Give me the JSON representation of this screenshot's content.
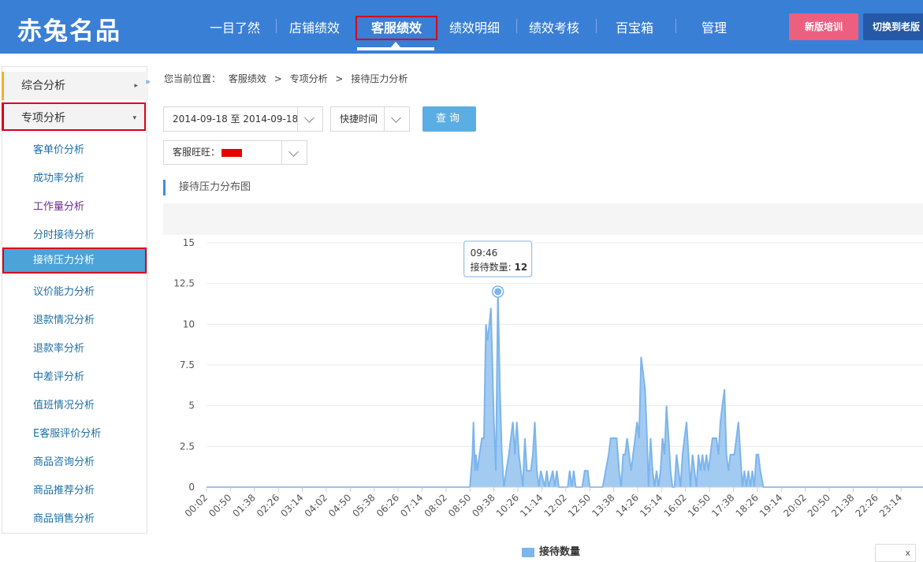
{
  "brand": {
    "logo": "赤兔名品"
  },
  "nav": {
    "items": [
      "一目了然",
      "店铺绩效",
      "客服绩效",
      "绩效明细",
      "绩效考核",
      "百宝箱",
      "管理"
    ],
    "active": "客服绩效"
  },
  "buttons": {
    "training": "新版培训",
    "switch_old": "切换到老版"
  },
  "sidebar": {
    "collapse_icon": "»",
    "groups": [
      {
        "label": "综合分析",
        "arrow": "▸"
      },
      {
        "label": "专项分析",
        "arrow": "▾"
      }
    ],
    "items": [
      "客单价分析",
      "成功率分析",
      "工作量分析",
      "分时接待分析",
      "接待压力分析",
      "议价能力分析",
      "退款情况分析",
      "退款率分析",
      "中差评分析",
      "值班情况分析",
      "E客服评价分析",
      "商品咨询分析",
      "商品推荐分析",
      "商品销售分析"
    ],
    "active_item": "接待压力分析"
  },
  "breadcrumb": {
    "prefix": "您当前位置：",
    "parts": [
      "客服绩效",
      "专项分析",
      "接待压力分析"
    ],
    "sep": ">"
  },
  "filters": {
    "date_range": "2014-09-18 至 2014-09-18",
    "quick_time": "快捷时间",
    "query_button": "查询",
    "wangwang_label": "客服旺旺："
  },
  "section_title": "接待压力分布图",
  "tooltip": {
    "time": "09:46",
    "label": "接待数量:",
    "value": "12"
  },
  "close_label": "x",
  "chart_data": {
    "type": "area",
    "title": "",
    "ylim": [
      0,
      15
    ],
    "yticks": [
      "0",
      "2.5",
      "5",
      "7.5",
      "10",
      "12.5",
      "15"
    ],
    "xtick_labels": [
      "00:02",
      "00:50",
      "01:38",
      "02:26",
      "03:14",
      "04:02",
      "04:50",
      "05:38",
      "06:26",
      "07:14",
      "08:02",
      "08:50",
      "09:38",
      "10:26",
      "11:14",
      "12:02",
      "12:50",
      "13:38",
      "14:26",
      "15:14",
      "16:02",
      "16:50",
      "17:38",
      "18:26",
      "19:14",
      "20:02",
      "20:50",
      "21:38",
      "22:26",
      "23:14"
    ],
    "series": [
      {
        "name": "接待数量",
        "color": "#7cb5ec",
        "points": [
          [
            "00:02",
            0
          ],
          [
            "08:50",
            0
          ],
          [
            "08:55",
            2
          ],
          [
            "08:57",
            4
          ],
          [
            "09:00",
            1
          ],
          [
            "09:02",
            2
          ],
          [
            "09:05",
            1
          ],
          [
            "09:09",
            2
          ],
          [
            "09:14",
            3
          ],
          [
            "09:18",
            3
          ],
          [
            "09:22",
            10
          ],
          [
            "09:25",
            9
          ],
          [
            "09:29",
            10
          ],
          [
            "09:32",
            11
          ],
          [
            "09:38",
            4
          ],
          [
            "09:42",
            1
          ],
          [
            "09:46",
            12
          ],
          [
            "09:50",
            6
          ],
          [
            "09:54",
            2
          ],
          [
            "09:58",
            0
          ],
          [
            "10:03",
            1
          ],
          [
            "10:08",
            2
          ],
          [
            "10:12",
            3
          ],
          [
            "10:16",
            4
          ],
          [
            "10:20",
            2
          ],
          [
            "10:24",
            4
          ],
          [
            "10:28",
            2
          ],
          [
            "10:32",
            1
          ],
          [
            "10:36",
            0
          ],
          [
            "10:40",
            3
          ],
          [
            "10:44",
            1
          ],
          [
            "10:48",
            1
          ],
          [
            "10:52",
            1
          ],
          [
            "10:56",
            2
          ],
          [
            "11:00",
            4
          ],
          [
            "11:04",
            1
          ],
          [
            "11:08",
            0
          ],
          [
            "11:12",
            1
          ],
          [
            "11:20",
            0
          ],
          [
            "11:24",
            1
          ],
          [
            "11:28",
            0
          ],
          [
            "11:36",
            1
          ],
          [
            "11:40",
            0
          ],
          [
            "11:44",
            1
          ],
          [
            "11:48",
            0
          ],
          [
            "12:06",
            0
          ],
          [
            "12:10",
            1
          ],
          [
            "12:14",
            0
          ],
          [
            "12:18",
            1
          ],
          [
            "12:22",
            0
          ],
          [
            "12:35",
            0
          ],
          [
            "12:40",
            1
          ],
          [
            "12:46",
            1
          ],
          [
            "12:50",
            0
          ],
          [
            "13:16",
            0
          ],
          [
            "13:22",
            1
          ],
          [
            "13:28",
            2
          ],
          [
            "13:32",
            3
          ],
          [
            "13:44",
            3
          ],
          [
            "13:49",
            1
          ],
          [
            "13:53",
            0
          ],
          [
            "13:57",
            2
          ],
          [
            "14:01",
            2
          ],
          [
            "14:05",
            3
          ],
          [
            "14:09",
            2
          ],
          [
            "14:13",
            1
          ],
          [
            "14:17",
            2
          ],
          [
            "14:21",
            3
          ],
          [
            "14:25",
            4
          ],
          [
            "14:29",
            3
          ],
          [
            "14:33",
            8
          ],
          [
            "14:37",
            7
          ],
          [
            "14:41",
            6
          ],
          [
            "14:45",
            3
          ],
          [
            "14:48",
            0
          ],
          [
            "14:52",
            3
          ],
          [
            "14:56",
            1
          ],
          [
            "15:00",
            0
          ],
          [
            "15:04",
            1
          ],
          [
            "15:08",
            0
          ],
          [
            "15:12",
            1
          ],
          [
            "15:16",
            3
          ],
          [
            "15:20",
            2
          ],
          [
            "15:24",
            5
          ],
          [
            "15:28",
            3
          ],
          [
            "15:32",
            1
          ],
          [
            "15:36",
            0
          ],
          [
            "15:40",
            0
          ],
          [
            "15:44",
            2
          ],
          [
            "15:48",
            1
          ],
          [
            "15:52",
            0
          ],
          [
            "15:56",
            2
          ],
          [
            "16:00",
            3
          ],
          [
            "16:04",
            4
          ],
          [
            "16:08",
            2
          ],
          [
            "16:12",
            0
          ],
          [
            "16:16",
            2
          ],
          [
            "16:20",
            1
          ],
          [
            "16:24",
            0
          ],
          [
            "16:28",
            2
          ],
          [
            "16:32",
            1
          ],
          [
            "16:36",
            2
          ],
          [
            "16:40",
            1
          ],
          [
            "16:44",
            2
          ],
          [
            "16:48",
            1
          ],
          [
            "16:52",
            2
          ],
          [
            "16:56",
            3
          ],
          [
            "17:00",
            3
          ],
          [
            "17:04",
            3
          ],
          [
            "17:08",
            2
          ],
          [
            "17:12",
            4
          ],
          [
            "17:16",
            5
          ],
          [
            "17:20",
            6
          ],
          [
            "17:24",
            2
          ],
          [
            "17:28",
            1
          ],
          [
            "17:32",
            2
          ],
          [
            "17:36",
            2
          ],
          [
            "17:40",
            2
          ],
          [
            "17:44",
            3
          ],
          [
            "17:48",
            4
          ],
          [
            "17:52",
            2
          ],
          [
            "17:56",
            0
          ],
          [
            "18:00",
            1
          ],
          [
            "18:04",
            0
          ],
          [
            "18:08",
            1
          ],
          [
            "18:12",
            0
          ],
          [
            "18:16",
            1
          ],
          [
            "18:20",
            0
          ],
          [
            "18:24",
            2
          ],
          [
            "18:28",
            2
          ],
          [
            "18:32",
            1
          ],
          [
            "18:38",
            0
          ],
          [
            "23:59",
            0
          ]
        ]
      }
    ]
  }
}
